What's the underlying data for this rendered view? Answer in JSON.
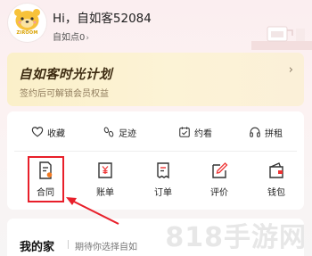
{
  "profile": {
    "greeting": "Hi，自如客52084",
    "points_label": "自如点0",
    "avatar_text": "ZIROOM",
    "chevron_icon": "chevron-right-icon"
  },
  "membership": {
    "title": "自如客时光计划",
    "subtitle": "签约后可解锁会员权益",
    "arrow": "›"
  },
  "quick_links": [
    {
      "label": "收藏",
      "icon": "heart-icon"
    },
    {
      "label": "足迹",
      "icon": "footprint-icon"
    },
    {
      "label": "约看",
      "icon": "calendar-check-icon"
    },
    {
      "label": "拼租",
      "icon": "headset-icon"
    }
  ],
  "tools": [
    {
      "label": "合同",
      "icon": "contract-icon"
    },
    {
      "label": "账单",
      "icon": "bill-yuan-icon"
    },
    {
      "label": "订单",
      "icon": "order-icon"
    },
    {
      "label": "评价",
      "icon": "edit-review-icon"
    },
    {
      "label": "钱包",
      "icon": "wallet-icon"
    }
  ],
  "home": {
    "title": "我的家",
    "subtitle": "期待你选择自如"
  },
  "annotation": {
    "highlight_color": "#e81f2a",
    "highlighted_tool": "合同"
  },
  "watermark": "818手游网",
  "colors": {
    "accent_red": "#e81f2a",
    "card_bg": "#fbf0c9",
    "page_bg": "#fbeef0"
  }
}
